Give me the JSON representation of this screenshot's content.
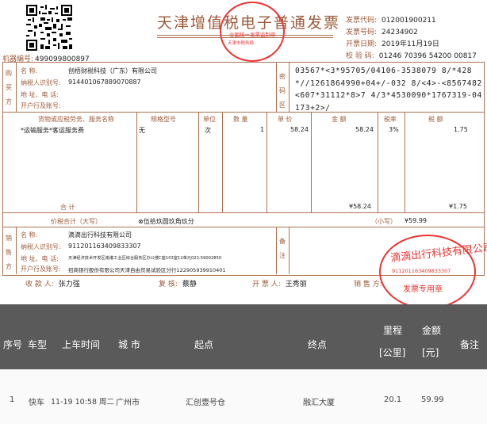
{
  "invoice": {
    "title": "天津增值税电子普通发票",
    "title_seal": {
      "line1": "全国统一发票监制章",
      "line2": "天津市税务局"
    },
    "code_label": "发票代码:",
    "code": "012001900211",
    "number_label": "发票号码:",
    "number": "24234902",
    "date_label": "开票日期:",
    "date": "2019年11月19日",
    "check_label": "校 验 码:",
    "check": "01246 70396 54200 00817",
    "machine_label": "机器编号:",
    "machine": "499099800897",
    "buyer": {
      "section": "购买方",
      "name_label": "名      称:",
      "name": "创梧财税科技（广东）有限公司",
      "tax_label": "纳税人识别号:",
      "tax": "914401067889070887",
      "addr_label": "地 址、电 话:",
      "bank_label": "开户行及账号:"
    },
    "cipher_section": "密码区",
    "cipher": "03567*<3*95705/04106-3538079 8/*428*//1261864990+04+/-032 8/<4>-<8567482<607*31112*8>7 4/3*4530090*1767319-04173+2>/",
    "items_header": {
      "name": "货物或应税劳务、服务名称",
      "spec": "规格型号",
      "unit": "单位",
      "qty": "数  量",
      "price": "单  价",
      "amount": "金  额",
      "rate": "税率",
      "tax": "税  额"
    },
    "item": {
      "name": "*运输服务*客运服务费",
      "spec": "无",
      "unit": "次",
      "qty": "1",
      "price": "58.24",
      "amount": "58.24",
      "rate": "3%",
      "tax": "1.75"
    },
    "total_label": "合        计",
    "total_amount": "¥58.24",
    "total_tax": "¥1.75",
    "grand_label": "价税合计（大写）",
    "grand_upper": "⊗伍拾玖圆玖角玖分",
    "grand_small_label": "（小写）",
    "grand_small": "¥59.99",
    "seller": {
      "section": "销售方",
      "name_label": "名      称:",
      "name": "滴滴出行科技有限公司",
      "tax_label": "纳税人识别号:",
      "tax": "911201163409833307",
      "addr_label": "地 址、电 话:",
      "addr": "天津经济技术开发区南港工业区综合服务区办公楼C座103室12单元022-59002850",
      "bank_label": "开户行及账号:",
      "bank": "招商银行股份有限公司天津自由贸易试验区分行122905939910401"
    },
    "remark_section": "备注",
    "payee_label": "收 款 人:",
    "payee": "张力强",
    "reviewer_label": "复 核:",
    "reviewer": "蔡静",
    "drawer_label": "开 票 人:",
    "drawer": "王秀丽",
    "seller_sign_label": "销 售 方:",
    "seller_seal": {
      "name": "滴滴出行科技有限公司",
      "number": "911201163409833307",
      "sub": "发票专用章"
    }
  },
  "trip_table": {
    "headers": [
      "序号",
      "车型",
      "上车时间",
      "城 市",
      "起点",
      "终点",
      "里程",
      "[公里]",
      "金额",
      "[元]",
      "备注"
    ],
    "row": [
      "1",
      "快车",
      "11-19 10:58 周二",
      "广州市",
      "汇创壹号仓",
      "融汇大厦",
      "20.1",
      "59.99",
      ""
    ]
  },
  "colors": {
    "brown": "#9b5a3a",
    "seal_red": "#e33",
    "header_gray": "#5a5a5a"
  }
}
